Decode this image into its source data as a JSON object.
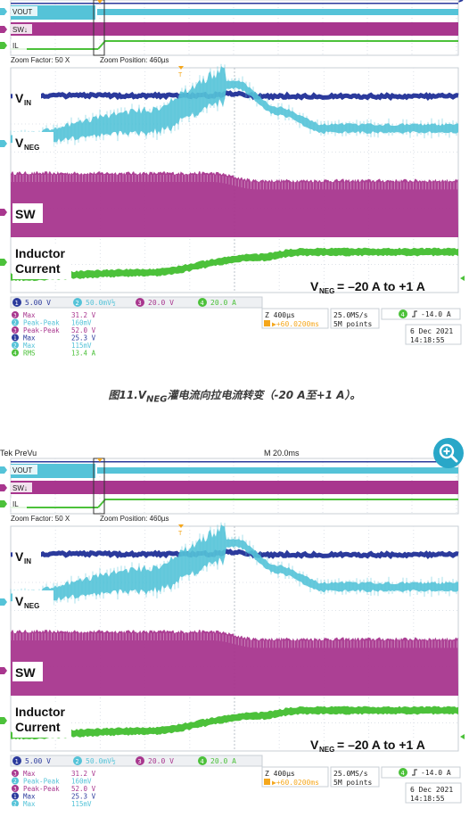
{
  "colors": {
    "ch1": "#2b3a9c",
    "ch2": "#55c3d8",
    "ch3": "#a8368e",
    "ch4": "#4cc13a",
    "ref": "#f5a71c",
    "grid": "#dde2e8",
    "frame": "#c9cfd6"
  },
  "overview": {
    "ch2_label": "VOUT",
    "ch3_label": "SW↓",
    "ch4_label": "IL"
  },
  "header": {
    "left": "Tek PreVu",
    "center": "M 20.0ms"
  },
  "zoom_bar": {
    "factor": "Zoom Factor: 50 X",
    "position": "Zoom Position: 460µs"
  },
  "waveform_labels": {
    "vin": "V",
    "vin_sub": "IN",
    "vneg": "V",
    "vneg_sub": "NEG",
    "sw": "SW",
    "inductor_1": "Inductor",
    "inductor_2": "Current",
    "annotation_main": "V",
    "annotation_sub": "NEG",
    "annotation_rest": " = –20 A to +1 A"
  },
  "channels": [
    {
      "num": "1",
      "scale": "5.00 V"
    },
    {
      "num": "2",
      "scale": "50.0mV½"
    },
    {
      "num": "3",
      "scale": "20.0 V"
    },
    {
      "num": "4",
      "scale": "20.0 A"
    }
  ],
  "measurements": [
    {
      "ch": "3",
      "name": "Max",
      "value": "31.2 V"
    },
    {
      "ch": "2",
      "name": "Peak-Peak",
      "value": "160mV"
    },
    {
      "ch": "3",
      "name": "Peak-Peak",
      "value": "52.0 V"
    },
    {
      "ch": "1",
      "name": "Max",
      "value": "25.3 V"
    },
    {
      "ch": "2",
      "name": "Max",
      "value": "115mV"
    },
    {
      "ch": "4",
      "name": "RMS",
      "value": "13.4 A"
    }
  ],
  "timebase": {
    "zoom": "Z 400µs",
    "delay": "▶+60.0200ms",
    "rate": "25.0MS/s",
    "points": "5M points",
    "trig_ch": "4",
    "trig_level": "-14.0 A"
  },
  "datetime": {
    "date": "6 Dec  2021",
    "time": "14:18:55"
  },
  "caption": {
    "prefix": "图11.V",
    "sub": "NEG",
    "suffix": "灌电流向拉电流转变（-20 A至+1 A）。"
  },
  "chart_data": {
    "type": "line",
    "xlabel": "",
    "ylabel": "",
    "x_divisions": 10,
    "series": [
      {
        "name": "V_IN",
        "channel": "1",
        "shape": [
          [
            0,
            0.93
          ],
          [
            0.44,
            0.93
          ],
          [
            0.5,
            0.99
          ],
          [
            0.56,
            0.91
          ],
          [
            1,
            0.91
          ]
        ]
      },
      {
        "name": "V_NEG",
        "channel": "2",
        "shape": [
          [
            0,
            0.2
          ],
          [
            0.3,
            0.45
          ],
          [
            0.5,
            0.99
          ],
          [
            0.6,
            0.6
          ],
          [
            0.7,
            0.35
          ],
          [
            1,
            0.35
          ]
        ]
      },
      {
        "name": "SW",
        "channel": "3",
        "shape": [
          [
            0,
            1
          ],
          [
            0.45,
            1
          ],
          [
            0.55,
            0.88
          ],
          [
            1,
            0.88
          ]
        ]
      },
      {
        "name": "Inductor Current",
        "channel": "4",
        "shape": [
          [
            0,
            0.05
          ],
          [
            0.3,
            0.2
          ],
          [
            0.55,
            0.75
          ],
          [
            0.65,
            0.95
          ],
          [
            1,
            0.95
          ]
        ]
      }
    ]
  }
}
